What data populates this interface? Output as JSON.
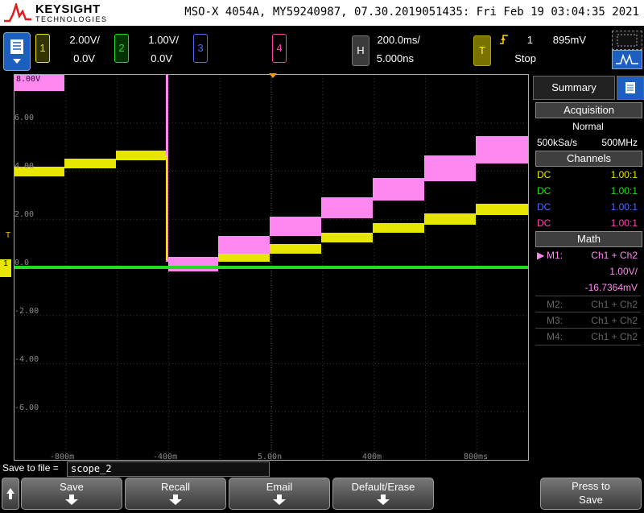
{
  "header": {
    "brand": "KEYSIGHT",
    "brand_sub": "TECHNOLOGIES",
    "info": "MSO-X 4054A, MY59240987, 07.30.2019051435: Fri Feb 19 03:04:35 2021"
  },
  "channels": [
    {
      "num": "1",
      "scale": "2.00V/",
      "offset": "0.0V",
      "color": "#e6e600"
    },
    {
      "num": "2",
      "scale": "1.00V/",
      "offset": "0.0V",
      "color": "#22dd22"
    },
    {
      "num": "3",
      "scale": "",
      "offset": "",
      "color": "#4d6bff"
    },
    {
      "num": "4",
      "scale": "",
      "offset": "",
      "color": "#ff44aa"
    }
  ],
  "horizontal": {
    "label": "H",
    "timebase": "200.0ms/",
    "delay": "5.000ns"
  },
  "trigger": {
    "label": "T",
    "source": "1",
    "level": "895mV",
    "status": "Stop"
  },
  "graticule": {
    "level_labels": [
      "8.00V",
      "6.00",
      "4.00",
      "2.00",
      "0.0",
      "-2.00",
      "-4.00",
      "-6.00"
    ],
    "time_labels": [
      "-800m",
      "-400m",
      "5.00n",
      "400m",
      "800ms"
    ],
    "trigger_marker": "T",
    "ground_marker": "1"
  },
  "panel": {
    "tab_label": "Summary",
    "acquisition_title": "Acquisition",
    "acq_mode": "Normal",
    "sample_rate": "500kSa/s",
    "bandwidth": "500MHz",
    "channels_title": "Channels",
    "channel_rows": [
      {
        "coupling": "DC",
        "ratio": "1.00:1",
        "color": "#e6e600"
      },
      {
        "coupling": "DC",
        "ratio": "1.00:1",
        "color": "#22dd22"
      },
      {
        "coupling": "DC",
        "ratio": "1.00:1",
        "color": "#4d6bff"
      },
      {
        "coupling": "DC",
        "ratio": "1.00:1",
        "color": "#ff44aa"
      }
    ],
    "math_title": "Math",
    "math_rows": [
      {
        "name": "M1:",
        "expr": "Ch1 + Ch2",
        "active": true
      },
      {
        "name": "M2:",
        "expr": "Ch1 + Ch2",
        "active": false
      },
      {
        "name": "M3:",
        "expr": "Ch1 + Ch2",
        "active": false
      },
      {
        "name": "M4:",
        "expr": "Ch1 + Ch2",
        "active": false
      }
    ],
    "m1_scale": "1.00V/",
    "m1_offset": "-16.7364mV"
  },
  "save": {
    "label": "Save to file =",
    "filename": "scope_2"
  },
  "softkeys": {
    "save": "Save",
    "recall": "Recall",
    "email": "Email",
    "default_erase": "Default/Erase",
    "press_to": "Press to",
    "press_save": "Save"
  },
  "traces": {
    "math_color": "#ff88f0",
    "ch1_color": "#e6e600",
    "ch2_color": "#22dd22"
  }
}
